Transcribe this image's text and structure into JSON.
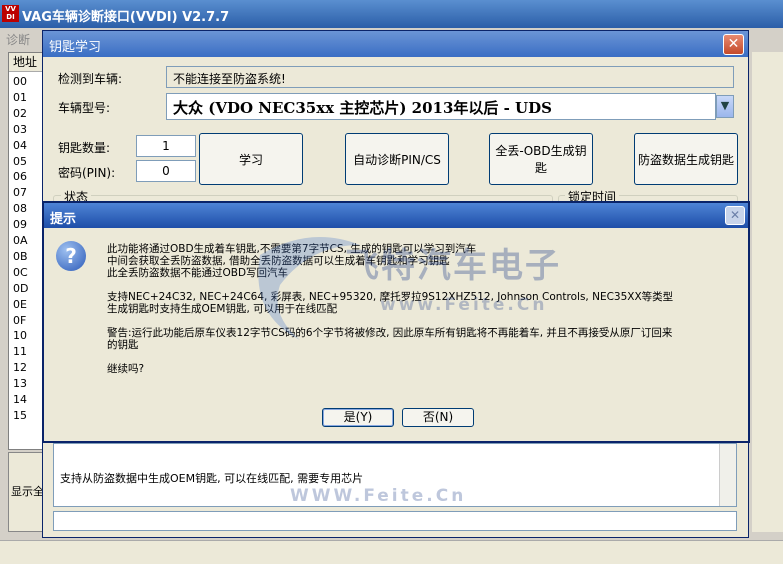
{
  "app": {
    "title": "VAG车辆诊断接口(VVDI)   V2.7.7",
    "logo_text": "VV DI",
    "menu_item": "诊断",
    "list_header": "地址",
    "list_rows": [
      "00",
      "01",
      "02",
      "03",
      "04",
      "05",
      "06",
      "07",
      "08",
      "09",
      "0A",
      "0B",
      "0C",
      "0D",
      "0E",
      "0F",
      "10",
      "11",
      "12",
      "13",
      "14",
      "15"
    ],
    "bottom_left_text": "显示全"
  },
  "key_dialog": {
    "title": "钥匙学习",
    "detected_label": "检测到车辆:",
    "detected_value": "不能连接至防盗系统!",
    "model_label": "车辆型号:",
    "model_value": "大众 (VDO NEC35xx 主控芯片) 2013年以后 - UDS",
    "key_count_label": "钥匙数量:",
    "key_count_value": "1",
    "pin_label": "密码(PIN):",
    "pin_value": "0",
    "buttons": {
      "learn": "学习",
      "auto_pin": "自动诊断PIN/CS",
      "all_lost": "全丢-OBD生成钥匙",
      "immo_data": "防盗数据生成钥匙"
    },
    "status_group": "状态",
    "lock_time_group": "锁定时间",
    "info_text": "支持从防盗数据中生成OEM钥匙, 可以在线匹配, 需要专用芯片"
  },
  "prompt": {
    "title": "提示",
    "lines": [
      "此功能将通过OBD生成着车钥匙,不需要第7字节CS, 生成的钥匙可以学习到汽车",
      "中间会获取全丢防盗数据, 借助全丢防盗数据可以生成着车钥匙和学习钥匙",
      "此全丢防盗数据不能通过OBD写回汽车",
      "支持NEC+24C32, NEC+24C64, 彩屏表, NEC+95320, 摩托罗拉9S12XHZ512, Johnson Controls, NEC35XX等类型",
      "生成钥匙时支持生成OEM钥匙, 可以用于在线匹配",
      "警告:运行此功能后原车仪表12字节CS码的6个字节将被修改, 因此原车所有钥匙将不再能着车, 并且不再接受从原厂订回来",
      "的钥匙",
      "继续吗?"
    ],
    "yes_label": "是(Y)",
    "no_label": "否(N)"
  },
  "watermark": {
    "brand": "飞特汽车电子",
    "url": "www.Feite.Cn",
    "url2": "WWW.Feite.Cn"
  }
}
